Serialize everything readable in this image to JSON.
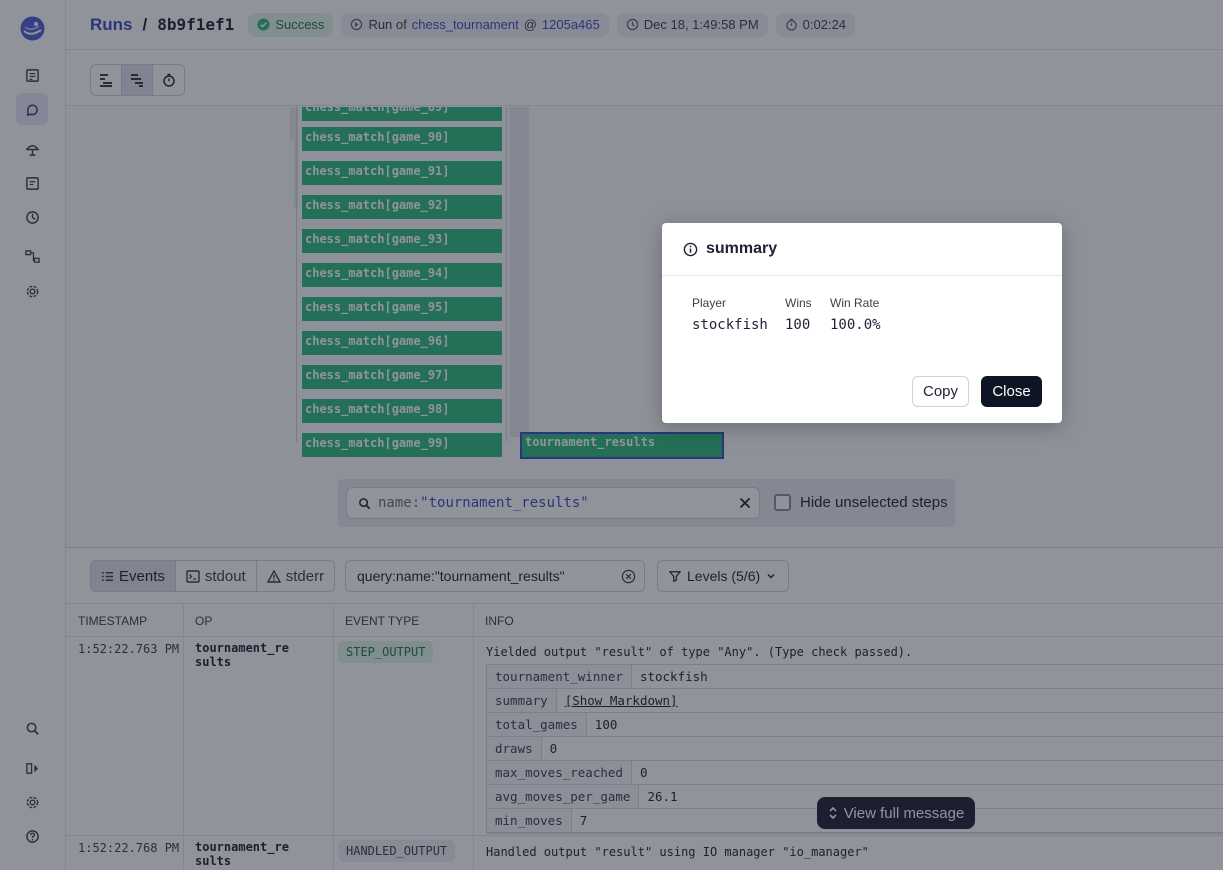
{
  "header": {
    "runs_label": "Runs",
    "separator": "/",
    "run_id": "8b9f1ef1",
    "status": "Success",
    "run_of_prefix": "Run of",
    "job_name": "chess_tournament",
    "at_symbol": "@",
    "snapshot": "1205a465",
    "started": "Dec 18, 1:49:58 PM",
    "duration": "0:02:24"
  },
  "graph": {
    "steps": [
      "chess_match[game_90]",
      "chess_match[game_91]",
      "chess_match[game_92]",
      "chess_match[game_93]",
      "chess_match[game_94]",
      "chess_match[game_95]",
      "chess_match[game_96]",
      "chess_match[game_97]",
      "chess_match[game_98]",
      "chess_match[game_99]"
    ],
    "final_step": "tournament_results",
    "search_key": "name:",
    "search_value": "\"tournament_results\"",
    "hide_unselected_label": "Hide unselected steps"
  },
  "logs": {
    "tabs": [
      "Events",
      "stdout",
      "stderr"
    ],
    "query": "query:name:\"tournament_results\"",
    "levels": "Levels (5/6)",
    "columns": [
      "TIMESTAMP",
      "OP",
      "EVENT TYPE",
      "INFO"
    ],
    "rows": [
      {
        "timestamp": "1:52:22.763 PM",
        "op": "tournament_results",
        "event_type": "STEP_OUTPUT",
        "info": "Yielded output \"result\" of type \"Any\". (Type check passed).",
        "metadata": [
          {
            "key": "tournament_winner",
            "value": "stockfish"
          },
          {
            "key": "summary",
            "value": "[Show Markdown]"
          },
          {
            "key": "total_games",
            "value": "100"
          },
          {
            "key": "draws",
            "value": "0"
          },
          {
            "key": "max_moves_reached",
            "value": "0"
          },
          {
            "key": "avg_moves_per_game",
            "value": "26.1"
          },
          {
            "key": "min_moves",
            "value": "7"
          }
        ]
      },
      {
        "timestamp": "1:52:22.768 PM",
        "op": "tournament_results",
        "event_type": "HANDLED_OUTPUT",
        "info": "Handled output \"result\" using IO manager \"io_manager\""
      }
    ],
    "view_full_label": "View full message"
  },
  "dialog": {
    "title": "summary",
    "table_headers": [
      "Player",
      "Wins",
      "Win Rate"
    ],
    "table_row": [
      "stockfish",
      "100",
      "100.0%"
    ],
    "copy_label": "Copy",
    "close_label": "Close"
  },
  "colors": {
    "accent": "#3a4dbf",
    "step_green": "#2dbb7d",
    "success_bg": "#e2f4ea"
  }
}
